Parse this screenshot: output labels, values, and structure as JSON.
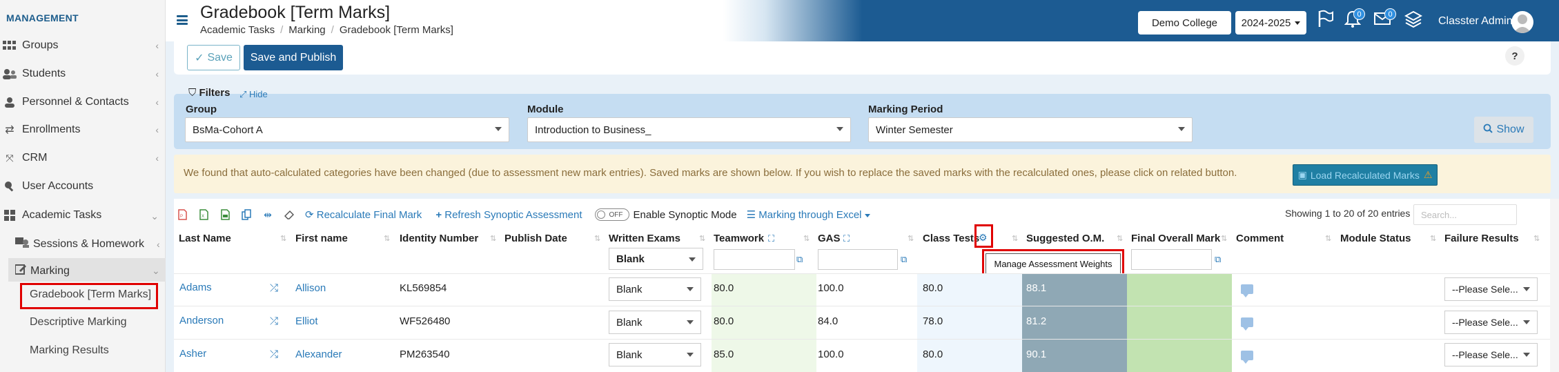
{
  "sidebar": {
    "section_title": "MANAGEMENT",
    "items": [
      {
        "label": "Groups",
        "icon": "groups-icon"
      },
      {
        "label": "Students",
        "icon": "students-icon"
      },
      {
        "label": "Personnel & Contacts",
        "icon": "person-icon"
      },
      {
        "label": "Enrollments",
        "icon": "exchange-icon"
      },
      {
        "label": "CRM",
        "icon": "crm-icon"
      },
      {
        "label": "User Accounts",
        "icon": "key-icon"
      },
      {
        "label": "Academic Tasks",
        "icon": "grid-icon"
      }
    ],
    "sub_items": [
      {
        "label": "Sessions & Homework"
      },
      {
        "label": "Marking"
      }
    ],
    "marking_items": [
      {
        "label": "Gradebook [Term Marks]"
      },
      {
        "label": "Descriptive Marking"
      },
      {
        "label": "Marking Results"
      }
    ]
  },
  "header": {
    "title": "Gradebook [Term Marks]",
    "breadcrumb": [
      "Academic Tasks",
      "Marking",
      "Gradebook [Term Marks]"
    ],
    "college": "Demo College",
    "year": "2024-2025",
    "notification_count": "0",
    "message_count": "0",
    "user_name": "Classter Admin"
  },
  "actions": {
    "save_label": "Save",
    "publish_label": "Save and Publish",
    "help_label": "?"
  },
  "filters": {
    "title": "Filters",
    "hide_label": "Hide",
    "group_label": "Group",
    "group_value": "BsMa-Cohort A",
    "module_label": "Module",
    "module_value": "Introduction to Business_",
    "period_label": "Marking Period",
    "period_value": "Winter Semester",
    "show_label": "Show"
  },
  "alert": {
    "text": "We found that auto-calculated categories have been changed (due to assessment new mark entries). Saved marks are shown below. If you wish to replace the saved marks with the recalculated ones, please click on related button.",
    "button_label": "Load Recalculated Marks"
  },
  "toolbar": {
    "recalculate_label": "Recalculate Final Mark",
    "refresh_label": "Refresh Synoptic Assessment",
    "toggle_label": "OFF",
    "synoptic_label": "Enable Synoptic Mode",
    "excel_label": "Marking through Excel",
    "showing_text": "Showing 1 to 20 of 20 entries",
    "search_placeholder": "Search..."
  },
  "table": {
    "columns": [
      "Last Name",
      "First name",
      "Identity Number",
      "Publish Date",
      "Written Exams",
      "Teamwork",
      "GAS",
      "Class Tests",
      "Suggested O.M.",
      "Final Overall Mark",
      "Comment",
      "Module Status",
      "Failure Results"
    ],
    "header_select_value": "Blank",
    "tooltip": "Manage Assessment Weights",
    "rows": [
      {
        "last": "Adams",
        "first": "Allison",
        "id": "KL569854",
        "written": "Blank",
        "teamwork": "80.0",
        "gas": "100.0",
        "class_tests": "80.0",
        "suggested": "88.1",
        "failure": "--Please Sele..."
      },
      {
        "last": "Anderson",
        "first": "Elliot",
        "id": "WF526480",
        "written": "Blank",
        "teamwork": "80.0",
        "gas": "84.0",
        "class_tests": "78.0",
        "suggested": "81.2",
        "failure": "--Please Sele..."
      },
      {
        "last": "Asher",
        "first": "Alexander",
        "id": "PM263540",
        "written": "Blank",
        "teamwork": "85.0",
        "gas": "100.0",
        "class_tests": "80.0",
        "suggested": "90.1",
        "failure": "--Please Sele..."
      }
    ]
  }
}
